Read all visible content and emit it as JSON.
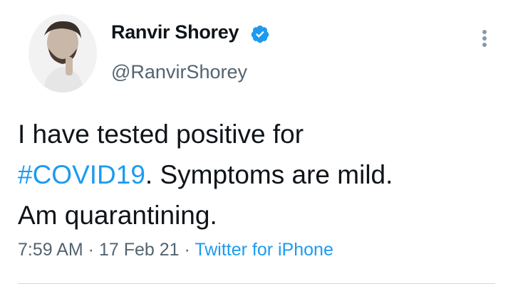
{
  "author": {
    "name": "Ranvir Shorey",
    "handle": "@RanvirShorey",
    "verified": true
  },
  "tweet": {
    "line1": "I have tested positive for",
    "hashtag": "#COVID19",
    "line2_rest": ". Symptoms are mild.",
    "line3": "Am quarantining."
  },
  "meta": {
    "time": "7:59 AM",
    "sep1": " · ",
    "date": "17 Feb 21",
    "sep2": " · ",
    "source": "Twitter for iPhone"
  },
  "colors": {
    "link": "#1d9bf0",
    "secondary_text": "#536471"
  },
  "icons": {
    "verified": "verified-badge-icon",
    "more": "more-options-icon"
  }
}
